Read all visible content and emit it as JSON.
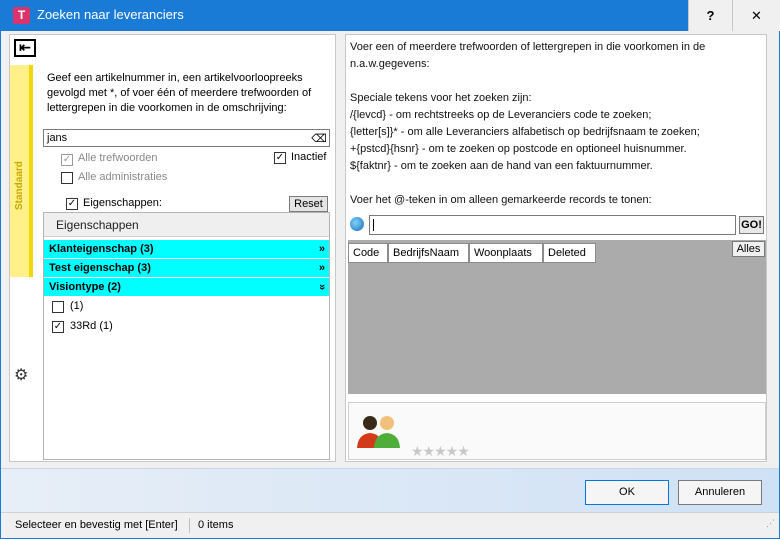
{
  "window": {
    "app_icon": "T",
    "title": "Zoeken naar leveranciers",
    "help_label": "?",
    "close_label": "✕"
  },
  "left": {
    "side_tab_label": "Standaard",
    "instructions": "Geef een artikelnummer in, een artikelvoorloopreeks gevolgd met *, of voer één of meerdere trefwoorden of lettergrepen in die voorkomen in de omschrijving:",
    "search_value": "jans",
    "options": {
      "alle_trefwoorden": "Alle trefwoorden",
      "inactief": "Inactief",
      "alle_administraties": "Alle administraties",
      "eigenschappen": "Eigenschappen:",
      "reset": "Reset"
    },
    "properties": {
      "header": "Eigenschappen",
      "groups": [
        {
          "label": "Klanteigenschap (3)",
          "chevron": "»"
        },
        {
          "label": "Test eigenschap (3)",
          "chevron": "»"
        },
        {
          "label": "Visiontype (2)",
          "chevron": "»"
        }
      ],
      "items": [
        {
          "label": "(1)",
          "checked": false
        },
        {
          "label": "33Rd (1)",
          "checked": true
        }
      ]
    }
  },
  "right": {
    "help_lines": [
      "Voer een of meerdere trefwoorden of lettergrepen in die voorkomen in de",
      "n.a.w.gegevens:",
      "",
      "Speciale tekens voor het zoeken zijn:",
      "/{levcd}  - om rechtstreeks op de Leveranciers code te zoeken;",
      "{letter[s]}*  - om alle Leveranciers alfabetisch op bedrijfsnaam te zoeken;",
      "+{pstcd}{hsnr}  - om te zoeken op postcode en optioneel huisnummer.",
      "${faktnr}  - om te zoeken aan de hand van een faktuurnummer.",
      "",
      "Voer het @-teken in om alleen gemarkeerde records te tonen:"
    ],
    "search_value": "",
    "go_label": "GO!",
    "columns": [
      "Code",
      "BedrijfsNaam",
      "Woonplaats",
      "Deleted"
    ],
    "alles_label": "Alles",
    "stars": "★★★★★"
  },
  "footer": {
    "ok_label": "OK",
    "cancel_label": "Annuleren",
    "status_text": "Selecteer en bevestig met [Enter]",
    "count_text": "0 items"
  },
  "colors": {
    "titlebar": "#1a7bd6",
    "group_bg": "#00ffff",
    "side_tab": "#fff089"
  }
}
